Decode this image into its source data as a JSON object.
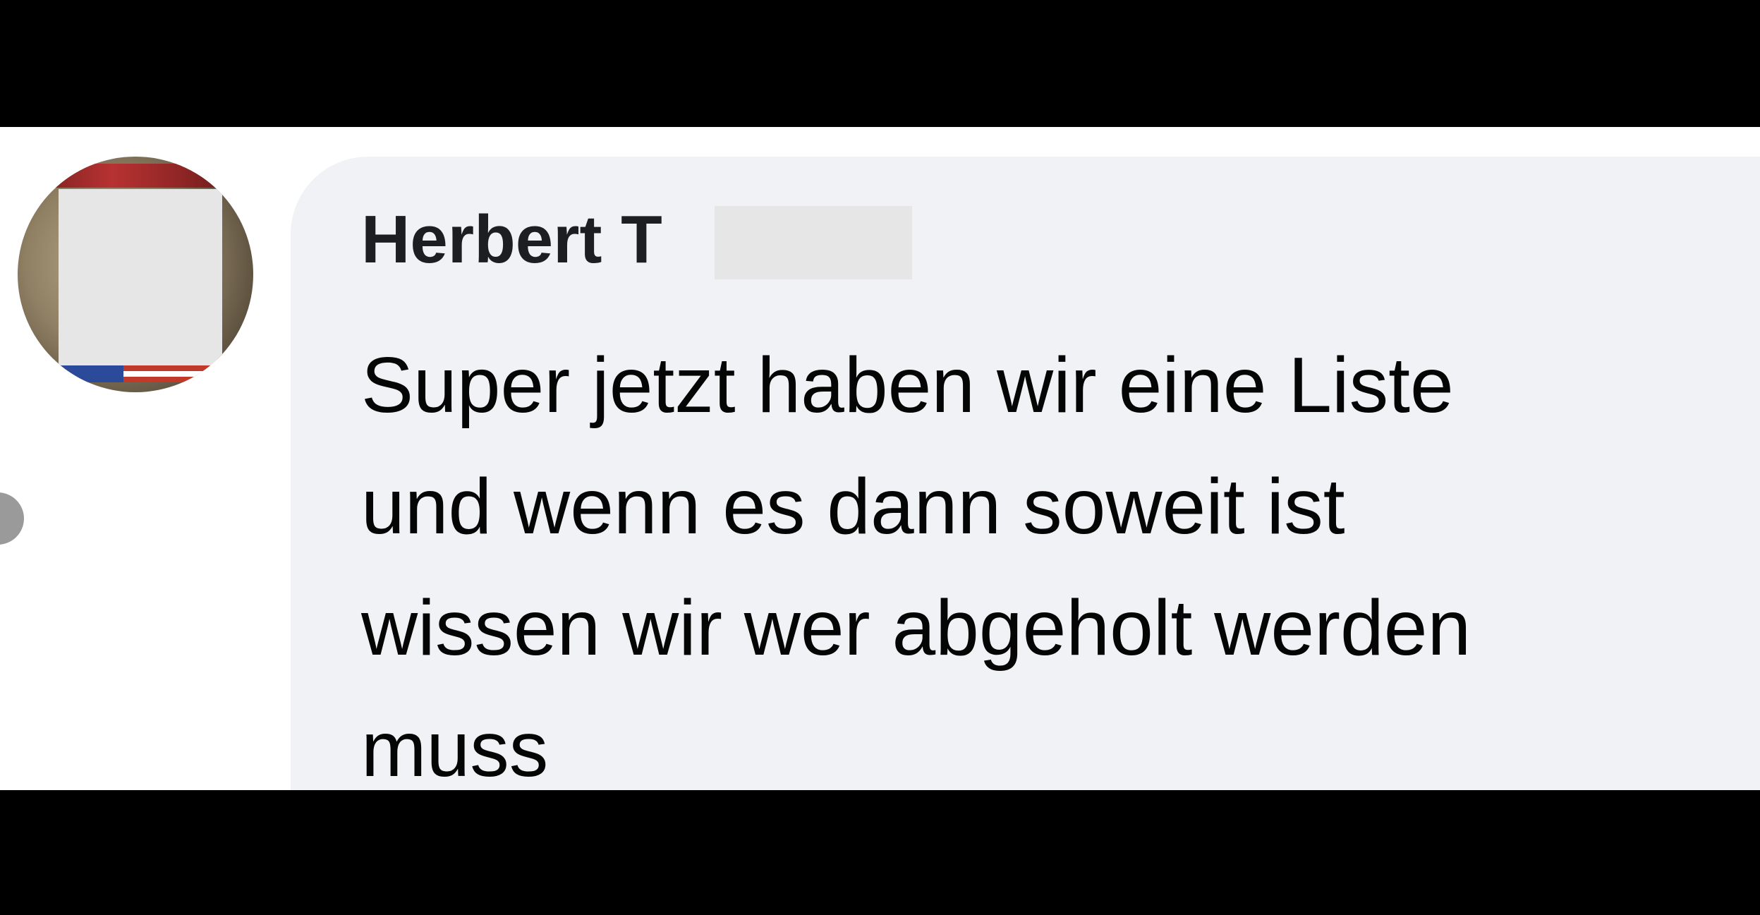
{
  "comment": {
    "author": "Herbert T",
    "text_lines": [
      "Super jetzt haben wir eine Liste",
      "und wenn es dann soweit ist",
      "wissen wir wer abgeholt werden",
      "muss"
    ]
  },
  "icons": {
    "avatar": "profile-picture",
    "side_handle": "chevron-left-icon"
  },
  "colors": {
    "bubble_background": "#f0f2f5",
    "author_text": "#1c1e21",
    "comment_text": "#050505",
    "letterbox": "#000000",
    "redaction": "#e6e6e6"
  }
}
